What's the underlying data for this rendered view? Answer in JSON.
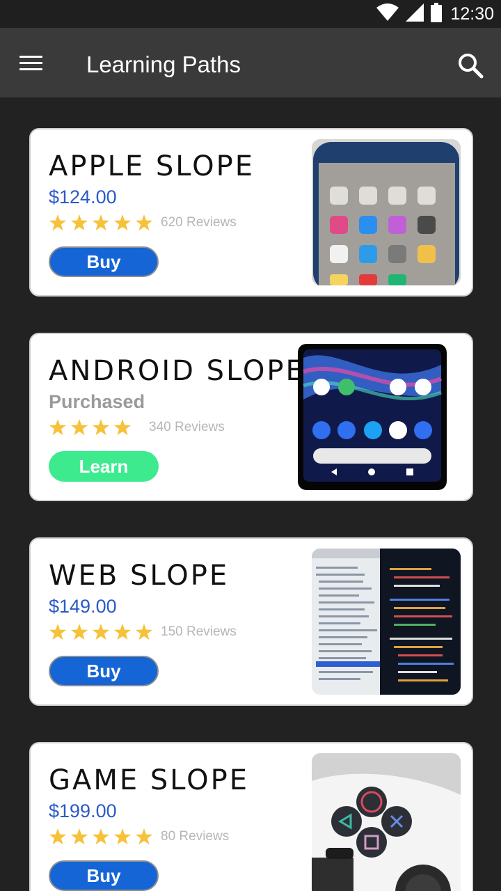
{
  "status_bar": {
    "time": "12:30"
  },
  "app_bar": {
    "title": "Learning Paths"
  },
  "icons": {
    "menu": "menu-icon",
    "search": "search-icon",
    "star": "star-icon"
  },
  "colors": {
    "price": "#2a59c9",
    "buy": "#1565d6",
    "learn": "#3deb8e",
    "star": "#f6c239"
  },
  "cards": [
    {
      "title": "APPLE SLOPE",
      "price": "$124.00",
      "rating": 5,
      "reviews": "620 Reviews",
      "action": "Buy",
      "image": "iphone-photo"
    },
    {
      "title": "ANDROID SLOPE",
      "price": "Purchased",
      "rating": 4,
      "reviews": "340 Reviews",
      "action": "Learn",
      "image": "android-phone-photo"
    },
    {
      "title": "WEB SLOPE",
      "price": "$149.00",
      "rating": 5,
      "reviews": "150 Reviews",
      "action": "Buy",
      "image": "code-editor-photo"
    },
    {
      "title": "GAME SLOPE",
      "price": "$199.00",
      "rating": 5,
      "reviews": "80 Reviews",
      "action": "Buy",
      "image": "game-controller-photo"
    }
  ]
}
